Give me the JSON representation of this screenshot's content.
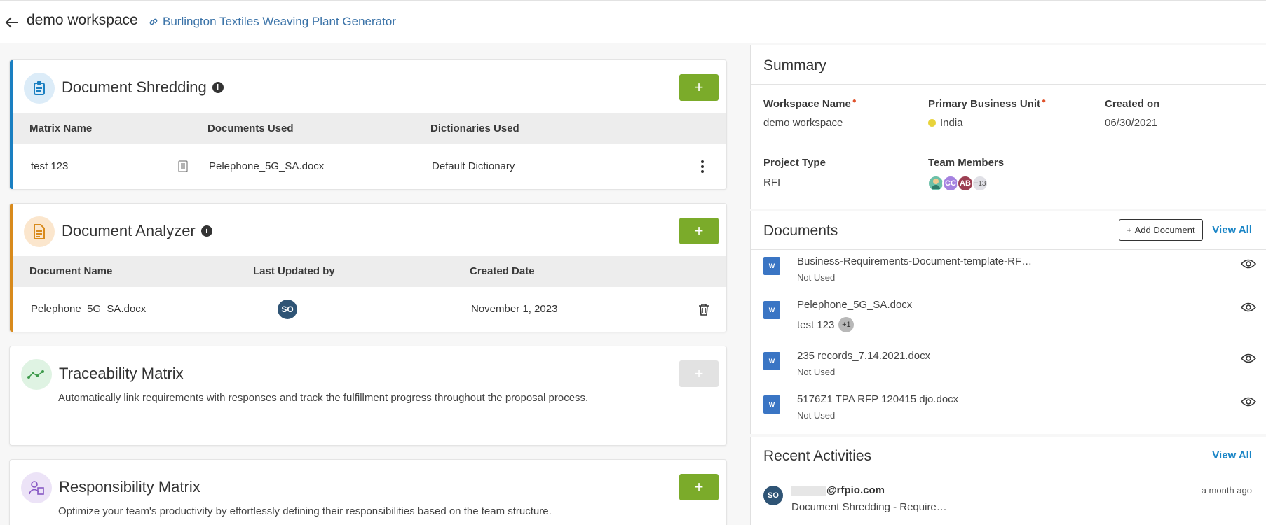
{
  "header": {
    "workspace_title": "demo workspace",
    "project_link": "Burlington Textiles Weaving Plant Generator"
  },
  "shredding": {
    "title": "Document Shredding",
    "add_label": "+",
    "columns": [
      "Matrix Name",
      "Documents Used",
      "Dictionaries Used"
    ],
    "row": {
      "matrix_name": "test 123",
      "documents_used": "Pelephone_5G_SA.docx",
      "dictionaries_used": "Default Dictionary"
    },
    "accent": "#1a7fc1"
  },
  "analyzer": {
    "title": "Document Analyzer",
    "add_label": "+",
    "columns": [
      "Document Name",
      "Last Updated by",
      "Created Date"
    ],
    "row": {
      "document_name": "Pelephone_5G_SA.docx",
      "updated_by": "SO",
      "created_date": "November 1, 2023"
    },
    "accent": "#d88a1c"
  },
  "traceability": {
    "title": "Traceability Matrix",
    "add_label": "+",
    "description": "Automatically link requirements with responses and track the fulfillment progress throughout the proposal process."
  },
  "responsibility": {
    "title": "Responsibility Matrix",
    "add_label": "+",
    "description": "Optimize your team's productivity by effortlessly defining their responsibilities based on the team structure."
  },
  "summary": {
    "title": "Summary",
    "workspace_name_label": "Workspace Name",
    "workspace_name": "demo workspace",
    "business_unit_label": "Primary Business Unit",
    "business_unit": "India",
    "created_on_label": "Created on",
    "created_on": "06/30/2021",
    "project_type_label": "Project Type",
    "project_type": "RFI",
    "team_members_label": "Team Members",
    "members": [
      "CC",
      "AB"
    ],
    "members_more": "+13"
  },
  "documents": {
    "title": "Documents",
    "add_label": "Add Document",
    "view_all": "View All",
    "items": [
      {
        "name": "Business-Requirements-Document-template-RF…",
        "status": "Not Used"
      },
      {
        "name": "Pelephone_5G_SA.docx",
        "status": "test 123",
        "badge": "+1"
      },
      {
        "name": "235 records_7.14.2021.docx",
        "status": "Not Used"
      },
      {
        "name": "5176Z1 TPA RFP 120415 djo.docx",
        "status": "Not Used"
      }
    ]
  },
  "activities": {
    "title": "Recent Activities",
    "view_all": "View All",
    "item": {
      "avatar": "SO",
      "email": "@rfpio.com",
      "text": "Document Shredding - Require…",
      "time": "a month ago"
    }
  },
  "colors": {
    "green": "#7bab2a",
    "link": "#3b73a8",
    "accent_blue": "#1a85c6"
  }
}
